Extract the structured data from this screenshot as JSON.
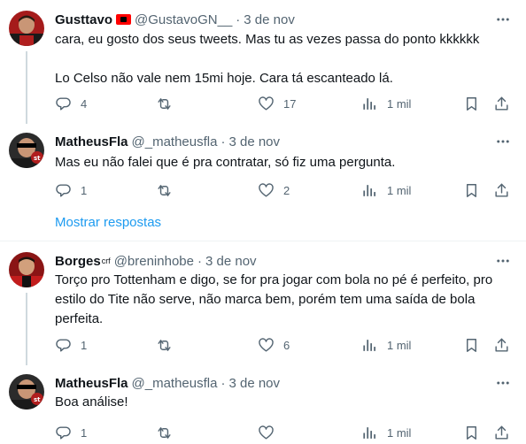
{
  "colors": {
    "accent": "#1d9bf0",
    "muted": "#536471",
    "text": "#0f1419",
    "divider": "#eff3f4"
  },
  "icons": {
    "reply": "reply-icon",
    "retweet": "retweet-icon",
    "like": "heart-icon",
    "views": "analytics-icon",
    "bookmark": "bookmark-icon",
    "share": "share-icon",
    "more": "more-icon"
  },
  "show_replies_label": "Mostrar respostas",
  "tweets": [
    {
      "name": "Gusttavo",
      "handle": "@GustavoGN__",
      "dot": "·",
      "date": "3 de nov",
      "text": "cara, eu gosto dos seus tweets. Mas tu as vezes passa do ponto kkkkkk\n\nLo Celso não vale nem 15mi hoje. Cara tá escanteado lá.",
      "replies": "4",
      "retweets": "",
      "likes": "17",
      "views": "1 mil"
    },
    {
      "name": "MatheusFla",
      "handle": "@_matheusfla",
      "dot": "·",
      "date": "3 de nov",
      "text": "Mas eu não falei que é pra contratar, só fiz uma pergunta.",
      "replies": "1",
      "retweets": "",
      "likes": "2",
      "views": "1 mil"
    },
    {
      "name": "Borges",
      "name_badge": "crf",
      "handle": "@breninhobe",
      "dot": "·",
      "date": "3 de nov",
      "text": "Torço pro Tottenham e digo, se for pra jogar com bola no pé é perfeito, pro estilo do Tite não serve, não marca bem, porém tem uma saída de bola perfeita.",
      "replies": "1",
      "retweets": "",
      "likes": "6",
      "views": "1 mil"
    },
    {
      "name": "MatheusFla",
      "handle": "@_matheusfla",
      "dot": "·",
      "date": "3 de nov",
      "text": "Boa análise!",
      "replies": "1",
      "retweets": "",
      "likes": "",
      "views": "1 mil"
    }
  ]
}
